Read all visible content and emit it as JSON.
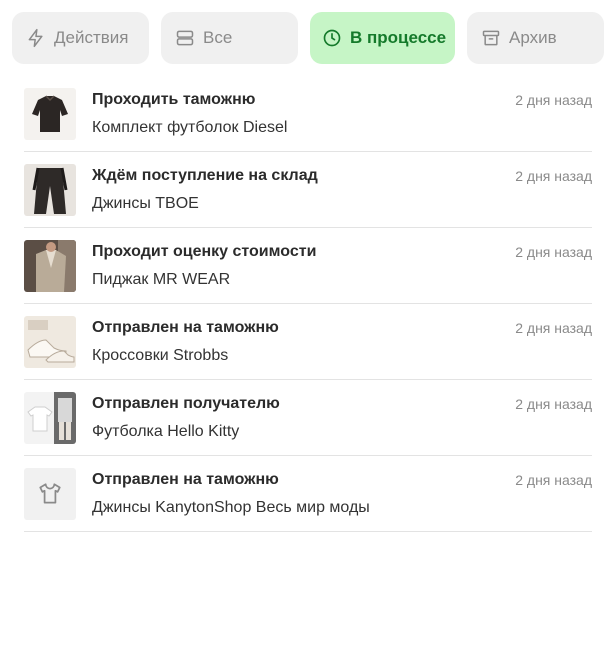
{
  "tabs": [
    {
      "label": "Действия",
      "icon": "lightning-icon",
      "active": false
    },
    {
      "label": "Все",
      "icon": "stack-icon",
      "active": false
    },
    {
      "label": "В процессе",
      "icon": "clock-icon",
      "active": true
    },
    {
      "label": "Архив",
      "icon": "archive-icon",
      "active": false
    }
  ],
  "colors": {
    "active_tab_bg": "#c6f5c6",
    "active_tab_text": "#157a2b",
    "tab_bg": "#f0f0f0",
    "muted_text": "#8a8a8a"
  },
  "orders": [
    {
      "status": "Проходить таможню",
      "product": "Комплект футболок Diesel",
      "time": "2 дня назад",
      "thumbnail": "black-shirt"
    },
    {
      "status": "Ждём поступление на склад",
      "product": "Джинсы TBOE",
      "time": "2 дня назад",
      "thumbnail": "dark-trousers"
    },
    {
      "status": "Проходит оценку стоимости",
      "product": "Пиджак MR WEAR",
      "time": "2 дня назад",
      "thumbnail": "blazer"
    },
    {
      "status": "Отправлен на таможню",
      "product": "Кроссовки Strobbs",
      "time": "2 дня назад",
      "thumbnail": "sneakers"
    },
    {
      "status": "Отправлен получателю",
      "product": "Футболка Hello Kitty",
      "time": "2 дня назад",
      "thumbnail": "white-tshirt"
    },
    {
      "status": "Отправлен на таможню",
      "product": "Джинсы KanytonShop Весь мир моды",
      "time": "2 дня назад",
      "thumbnail": "placeholder-tshirt-icon"
    }
  ]
}
